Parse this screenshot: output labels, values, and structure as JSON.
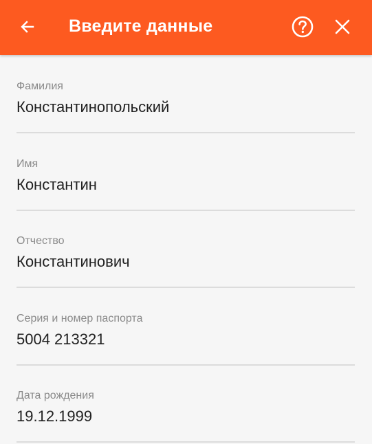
{
  "header": {
    "title": "Введите данные",
    "back_icon": "arrow-left-icon",
    "help_icon": "help-circle-icon",
    "close_icon": "close-icon",
    "background_color": "#fd5a20",
    "foreground_color": "#ffffff"
  },
  "form": {
    "fields": [
      {
        "label": "Фамилия",
        "value": "Константинопольский"
      },
      {
        "label": "Имя",
        "value": "Константин"
      },
      {
        "label": "Отчество",
        "value": "Константинович"
      },
      {
        "label": "Серия и номер паспорта",
        "value": "5004 213321"
      },
      {
        "label": "Дата рождения",
        "value": "19.12.1999"
      }
    ]
  }
}
